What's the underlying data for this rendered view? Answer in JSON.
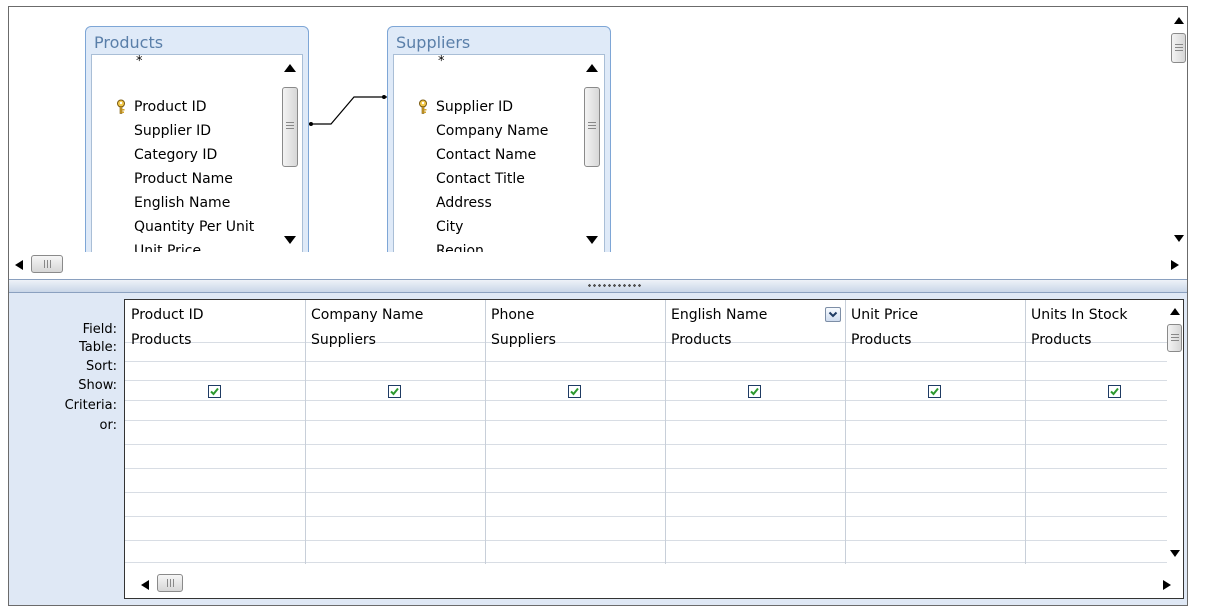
{
  "tables": [
    {
      "title": "Products",
      "star": "*",
      "fields": [
        "Product ID",
        "Supplier ID",
        "Category ID",
        "Product Name",
        "English Name",
        "Quantity Per Unit",
        "Unit Price"
      ],
      "primary_key": "Product ID"
    },
    {
      "title": "Suppliers",
      "star": "*",
      "fields": [
        "Supplier ID",
        "Company Name",
        "Contact Name",
        "Contact Title",
        "Address",
        "City",
        "Region"
      ],
      "primary_key": "Supplier ID"
    }
  ],
  "relationship": {
    "from": "Products.Supplier ID",
    "to": "Suppliers.Supplier ID"
  },
  "row_labels": [
    "Field:",
    "Table:",
    "Sort:",
    "Show:",
    "Criteria:",
    "or:"
  ],
  "columns": [
    {
      "field": "Product ID",
      "table": "Products",
      "sort": "",
      "show": true
    },
    {
      "field": "Company Name",
      "table": "Suppliers",
      "sort": "",
      "show": true
    },
    {
      "field": "Phone",
      "table": "Suppliers",
      "sort": "",
      "show": true
    },
    {
      "field": "English Name",
      "table": "Products",
      "sort": "",
      "show": true,
      "has_dropdown": true
    },
    {
      "field": "Unit Price",
      "table": "Products",
      "sort": "",
      "show": true
    },
    {
      "field": "Units In Stock",
      "table": "Products",
      "sort": "",
      "show": true
    }
  ],
  "icons": {
    "key": "key-icon",
    "checkbox": "checkbox-checked-icon",
    "dropdown": "chevron-down-icon"
  },
  "colors": {
    "pane_blue": "#dfe8f5",
    "field_list_border": "#7ea6d6",
    "field_list_title": "#5a7fa9",
    "check_green": "#2e9a2e"
  }
}
